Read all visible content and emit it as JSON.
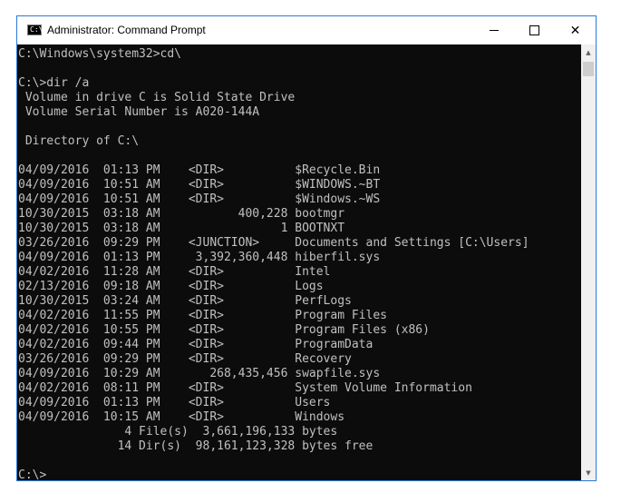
{
  "window": {
    "title": "Administrator: Command Prompt",
    "icon_label": "C:\\"
  },
  "controls": {
    "minimize_icon": "minimize-icon",
    "maximize_icon": "maximize-icon",
    "close_glyph": "✕"
  },
  "scrollbar": {
    "up_glyph": "▲",
    "down_glyph": "▼"
  },
  "console": {
    "lines": [
      "C:\\Windows\\system32>cd\\",
      "",
      "C:\\>dir /a",
      " Volume in drive C is Solid State Drive",
      " Volume Serial Number is A020-144A",
      "",
      " Directory of C:\\",
      "",
      "04/09/2016  01:13 PM    <DIR>          $Recycle.Bin",
      "04/09/2016  10:51 AM    <DIR>          $WINDOWS.~BT",
      "04/09/2016  10:51 AM    <DIR>          $Windows.~WS",
      "10/30/2015  03:18 AM           400,228 bootmgr",
      "10/30/2015  03:18 AM                 1 BOOTNXT",
      "03/26/2016  09:29 PM    <JUNCTION>     Documents and Settings [C:\\Users]",
      "04/09/2016  01:13 PM     3,392,360,448 hiberfil.sys",
      "04/02/2016  11:28 AM    <DIR>          Intel",
      "02/13/2016  09:18 AM    <DIR>          Logs",
      "10/30/2015  03:24 AM    <DIR>          PerfLogs",
      "04/02/2016  11:55 PM    <DIR>          Program Files",
      "04/02/2016  10:55 PM    <DIR>          Program Files (x86)",
      "04/02/2016  09:44 PM    <DIR>          ProgramData",
      "03/26/2016  09:29 PM    <DIR>          Recovery",
      "04/09/2016  10:29 AM       268,435,456 swapfile.sys",
      "04/02/2016  08:11 PM    <DIR>          System Volume Information",
      "04/09/2016  01:13 PM    <DIR>          Users",
      "04/09/2016  10:15 AM    <DIR>          Windows",
      "               4 File(s)  3,661,196,133 bytes",
      "              14 Dir(s)  98,161,123,328 bytes free",
      "",
      "C:\\>"
    ]
  }
}
